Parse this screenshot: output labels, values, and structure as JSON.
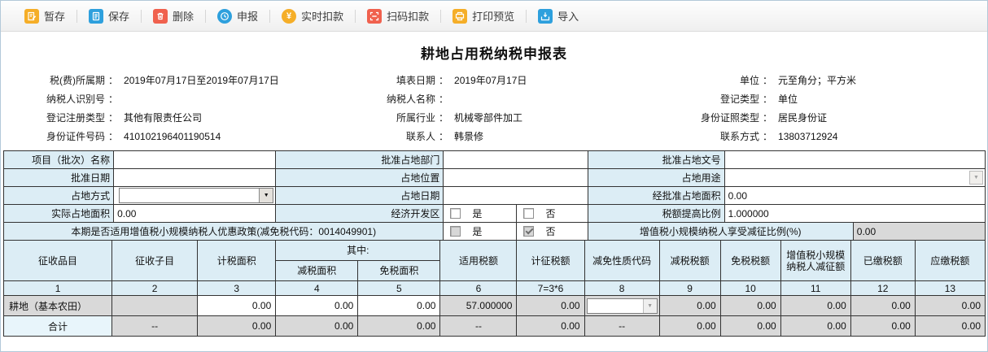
{
  "page": {
    "title": "耕地占用税纳税申报表"
  },
  "punct": {
    "colon": "："
  },
  "icons": {
    "dropdown_arrow": "▼",
    "yen_symbol": "¥"
  },
  "colors": {
    "accent_yellow": "#f5ae28",
    "accent_blue": "#2ea0dd",
    "accent_red": "#f0614e",
    "header_cell_bg": "#dcedf5",
    "readonly_bg": "#d9d9d9",
    "total_label_bg": "#e8f5fb",
    "table_border": "#333333"
  },
  "toolbar": {
    "buttons": [
      {
        "label": "暂存",
        "icon": "draft-icon",
        "color": "#f5ae28"
      },
      {
        "label": "保存",
        "icon": "save-icon",
        "color": "#2ea0dd"
      },
      {
        "label": "删除",
        "icon": "delete-icon",
        "color": "#f0614e"
      },
      {
        "label": "申报",
        "icon": "declare-icon",
        "color": "#2ea0dd"
      },
      {
        "label": "实时扣款",
        "icon": "realtime-pay-icon",
        "color": "#f5ae28"
      },
      {
        "label": "扫码扣款",
        "icon": "scan-pay-icon",
        "color": "#f0614e"
      },
      {
        "label": "打印预览",
        "icon": "print-preview-icon",
        "color": "#f5ae28"
      },
      {
        "label": "导入",
        "icon": "import-icon",
        "color": "#2ea0dd"
      }
    ]
  },
  "header_info": {
    "fields": [
      {
        "label": "税(费)所属期",
        "value": "2019年07月17日至2019年07月17日"
      },
      {
        "label": "填表日期",
        "value": "2019年07月17日"
      },
      {
        "label": "单位",
        "value": "元至角分；平方米"
      },
      {
        "label": "纳税人识别号",
        "value": ""
      },
      {
        "label": "纳税人名称",
        "value": ""
      },
      {
        "label": "登记类型",
        "value": "单位"
      },
      {
        "label": "登记注册类型",
        "value": "其他有限责任公司"
      },
      {
        "label": "所属行业",
        "value": "机械零部件加工"
      },
      {
        "label": "身份证照类型",
        "value": "居民身份证"
      },
      {
        "label": "身份证件号码",
        "value": "410102196401190514"
      },
      {
        "label": "联系人",
        "value": "韩景修"
      },
      {
        "label": "联系方式",
        "value": "13803712924"
      }
    ]
  },
  "form_grid": {
    "row1": [
      {
        "label": "项目（批次）名称",
        "value": ""
      },
      {
        "label": "批准占地部门",
        "value": ""
      },
      {
        "label": "批准占地文号",
        "value": ""
      }
    ],
    "row2": [
      {
        "label": "批准日期",
        "value": ""
      },
      {
        "label": "占地位置",
        "value": ""
      },
      {
        "label": "占地用途",
        "value": ""
      }
    ],
    "row3": [
      {
        "label": "占地方式",
        "value": ""
      },
      {
        "label": "占地日期",
        "value": ""
      },
      {
        "label": "经批准占地面积",
        "value": "0.00"
      }
    ],
    "row4": {
      "label1": "实际占地面积",
      "value1": "0.00",
      "label2": "经济开发区",
      "yes_label": "是",
      "no_label": "否",
      "label3": "税额提高比例",
      "value3": "1.000000"
    },
    "row5": {
      "label": "本期是否适用增值税小规模纳税人优惠政策(减免税代码：0014049901)",
      "yes_label": "是",
      "no_label": "否",
      "label2": "增值税小规模纳税人享受减征比例(%)",
      "value": "0.00"
    }
  },
  "main_table": {
    "col_headers": [
      "征收品目",
      "征收子目",
      "计税面积",
      "减税面积",
      "免税面积",
      "适用税额",
      "计征税额",
      "减免性质代码",
      "减税税额",
      "免税税额",
      "增值税小规模纳税人减征额",
      "已缴税额",
      "应缴税额"
    ],
    "among_label": "其中:",
    "col_numbers": [
      "1",
      "2",
      "3",
      "4",
      "5",
      "6",
      "7=3*6",
      "8",
      "9",
      "10",
      "11",
      "12",
      "13"
    ],
    "row_farmland": {
      "name": "耕地（基本农田）",
      "subitem": "",
      "tax_area": "0.00",
      "reduced_area": "0.00",
      "exempt_area": "0.00",
      "applicable_rate": "57.000000",
      "levied_tax": "0.00",
      "reduction_code": "",
      "reduced_tax": "0.00",
      "exempt_tax": "0.00",
      "small_scale_reduction": "0.00",
      "paid_tax": "0.00",
      "payable_tax": "0.00"
    },
    "row_total": {
      "name": "合计",
      "subitem": "--",
      "tax_area": "0.00",
      "reduced_area": "0.00",
      "exempt_area": "0.00",
      "applicable_rate": "--",
      "levied_tax": "0.00",
      "reduction_code": "--",
      "reduced_tax": "0.00",
      "exempt_tax": "0.00",
      "small_scale_reduction": "0.00",
      "paid_tax": "0.00",
      "payable_tax": "0.00"
    }
  }
}
